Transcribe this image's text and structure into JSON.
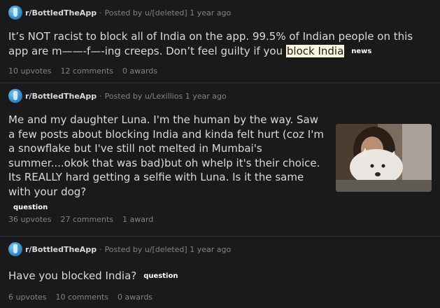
{
  "posts": [
    {
      "subreddit": "r/BottledTheApp",
      "posted_by": "Posted by u/[deleted]",
      "age": "1 year ago",
      "title_before": "It’s NOT racist to block all of India on the app. 99.5% of Indian people on this app are m——-f—-ing creeps. Don’t feel guilty if you ",
      "title_highlight": "block India",
      "flair": "news",
      "upvotes": "10 upvotes",
      "comments": "12 comments",
      "awards": "0 awards"
    },
    {
      "subreddit": "r/BottledTheApp",
      "posted_by": "Posted by u/Lexillios",
      "age": "1 year ago",
      "title": "Me and my daughter Luna. I'm the human by the way. Saw a few posts about blocking India and kinda felt hurt (coz I'm a snowflake but I've still not melted in Mumbai's summer....okok that was bad)but oh whelp it's their choice. Its REALLY hard getting a selfie with Luna. Is it the same with your dog?",
      "flair": "question",
      "upvotes": "36 upvotes",
      "comments": "27 comments",
      "awards": "1 award"
    },
    {
      "subreddit": "r/BottledTheApp",
      "posted_by": "Posted by u/[deleted]",
      "age": "1 year ago",
      "title": "Have you blocked India?",
      "flair": "question",
      "upvotes": "6 upvotes",
      "comments": "10 comments",
      "awards": "0 awards"
    }
  ],
  "separator": "·",
  "icons": {
    "subreddit_avatar": "bottle-avatar-icon",
    "post_thumbnail": "selfie-with-dog-image"
  },
  "colors": {
    "background": "#1a1a1b",
    "text": "#d7dadc",
    "muted": "#818384",
    "highlight": "#fff8dc",
    "divider": "#343536"
  }
}
